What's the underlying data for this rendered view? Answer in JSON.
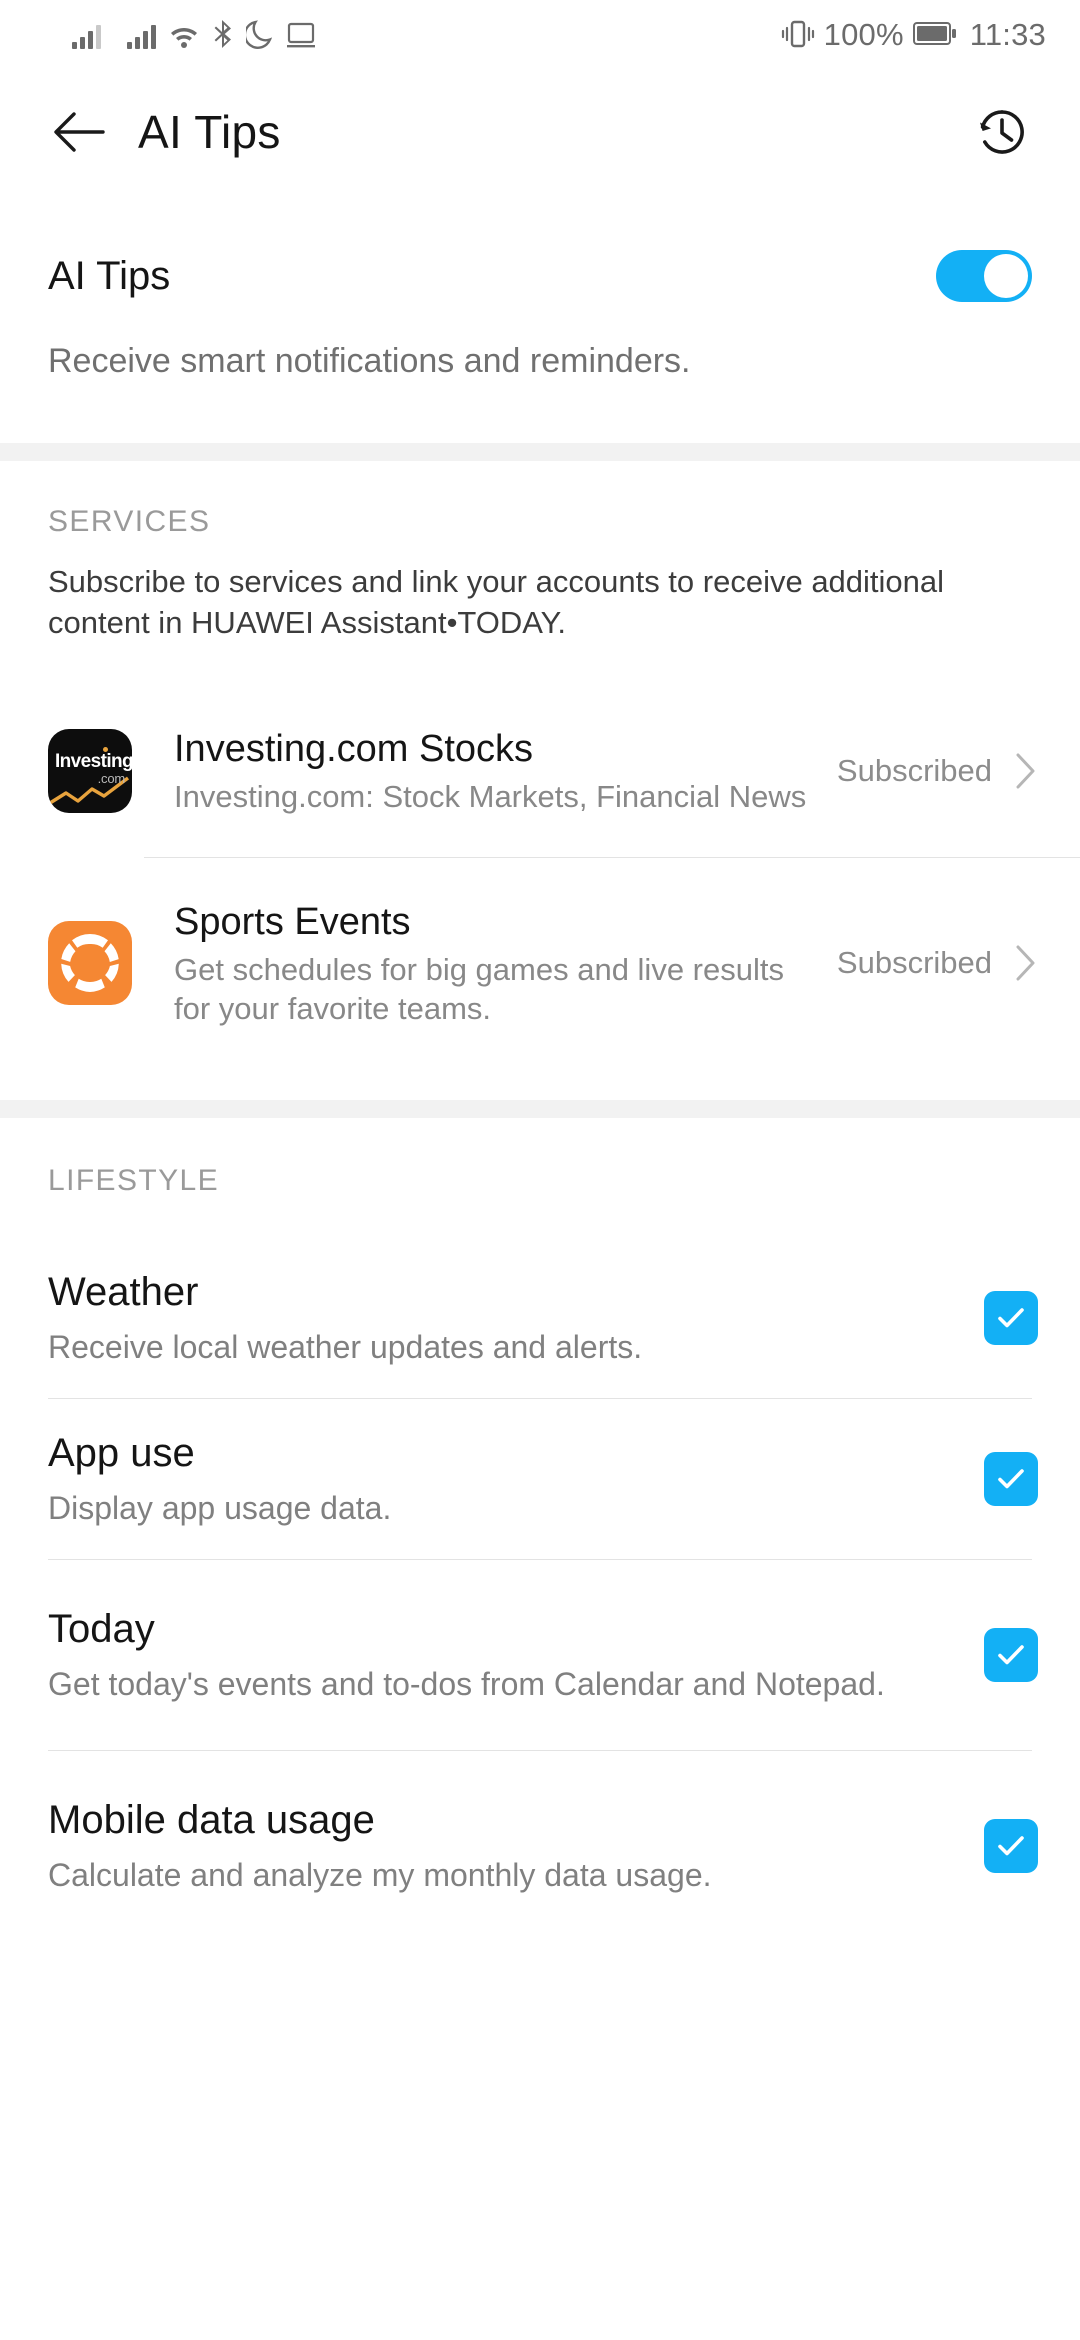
{
  "theme": {
    "accent": "#13b0f5",
    "checkbox_color": "#13b0f5",
    "divider": "#e3e3e3",
    "section_bg": "#f2f2f2",
    "investing_icon_bg": "#0d0d0d",
    "investing_icon_accent": "#e8a33d",
    "sports_icon_bg": "#f58733"
  },
  "status_bar": {
    "signal1": "signal-bars-icon",
    "signal2": "signal-bars-icon",
    "wifi": "wifi-icon",
    "bluetooth": "bluetooth-icon",
    "do_not_disturb": "moon-icon",
    "cast": "screen-cast-icon",
    "vibrate": "vibrate-icon",
    "battery_percent": "100%",
    "battery": "battery-full-icon",
    "time": "11:33"
  },
  "app_bar": {
    "back_icon": "back-arrow-icon",
    "title": "AI Tips",
    "history_icon": "history-clock-icon"
  },
  "master": {
    "title": "AI Tips",
    "description": "Receive smart notifications and reminders.",
    "toggle_on": true
  },
  "services": {
    "label": "SERVICES",
    "description": "Subscribe to services and link your accounts to receive additional content in HUAWEI Assistant•TODAY.",
    "items": [
      {
        "icon": "investing-com-app-icon",
        "icon_word": "Investing",
        "icon_suffix": ".com",
        "title": "Investing.com Stocks",
        "subtitle": "Investing.com: Stock Markets, Financial News",
        "status": "Subscribed",
        "chevron": "chevron-right-icon"
      },
      {
        "icon": "sports-events-app-icon",
        "icon_word": "",
        "icon_suffix": "",
        "title": "Sports Events",
        "subtitle": "Get schedules for big games and live results for your favorite teams.",
        "status": "Subscribed",
        "chevron": "chevron-right-icon"
      }
    ]
  },
  "lifestyle": {
    "label": "LIFESTYLE",
    "items": [
      {
        "title": "Weather",
        "subtitle": "Receive local weather updates and alerts.",
        "checked": true
      },
      {
        "title": "App use",
        "subtitle": "Display app usage data.",
        "checked": true
      },
      {
        "title": "Today",
        "subtitle": "Get today's events and to-dos from Calendar and Notepad.",
        "checked": true
      },
      {
        "title": "Mobile data usage",
        "subtitle": "Calculate and analyze my monthly data usage.",
        "checked": true
      }
    ]
  }
}
